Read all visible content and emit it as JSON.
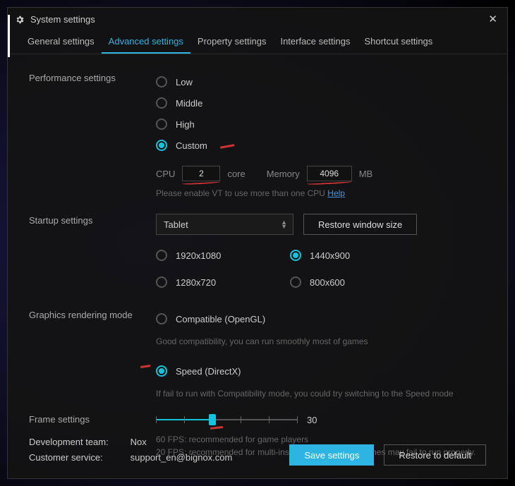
{
  "window": {
    "title": "System settings"
  },
  "tabs": [
    {
      "label": "General settings",
      "active": false,
      "name": "tab-general"
    },
    {
      "label": "Advanced settings",
      "active": true,
      "name": "tab-advanced"
    },
    {
      "label": "Property settings",
      "active": false,
      "name": "tab-property"
    },
    {
      "label": "Interface settings",
      "active": false,
      "name": "tab-interface"
    },
    {
      "label": "Shortcut settings",
      "active": false,
      "name": "tab-shortcut"
    }
  ],
  "perf": {
    "section_label": "Performance settings",
    "options": {
      "low": "Low",
      "middle": "Middle",
      "high": "High",
      "custom": "Custom"
    },
    "selected": "custom",
    "cpu_label": "CPU",
    "cpu_value": "2",
    "core_label": "core",
    "mem_label": "Memory",
    "mem_value": "4096",
    "mb_label": "MB",
    "vt_hint": "Please enable VT to use more than one CPU",
    "vt_link": "Help"
  },
  "startup": {
    "section_label": "Startup settings",
    "mode_select": "Tablet",
    "restore_btn": "Restore window size",
    "resolutions": {
      "r1": "1920x1080",
      "r2": "1440x900",
      "r3": "1280x720",
      "r4": "800x600"
    },
    "selected": "r2"
  },
  "graphics": {
    "section_label": "Graphics rendering mode",
    "compat_label": "Compatible (OpenGL)",
    "compat_hint": "Good compatibility, you can run smoothly most of games",
    "speed_label": "Speed (DirectX)",
    "speed_hint": "If fail to run with Compatibility mode, you could try switching to the Speed mode",
    "selected": "speed"
  },
  "frame": {
    "section_label": "Frame settings",
    "value": "30",
    "hint1": "60 FPS: recommended for game players",
    "hint2": "20 FPS: recommended for multi-instance users. A few games may fail to run properly."
  },
  "footer": {
    "dev_label": "Development team:",
    "dev_value": "Nox",
    "cs_label": "Customer service:",
    "cs_value": "support_en@bignox.com",
    "save": "Save settings",
    "restore": "Restore to default"
  }
}
